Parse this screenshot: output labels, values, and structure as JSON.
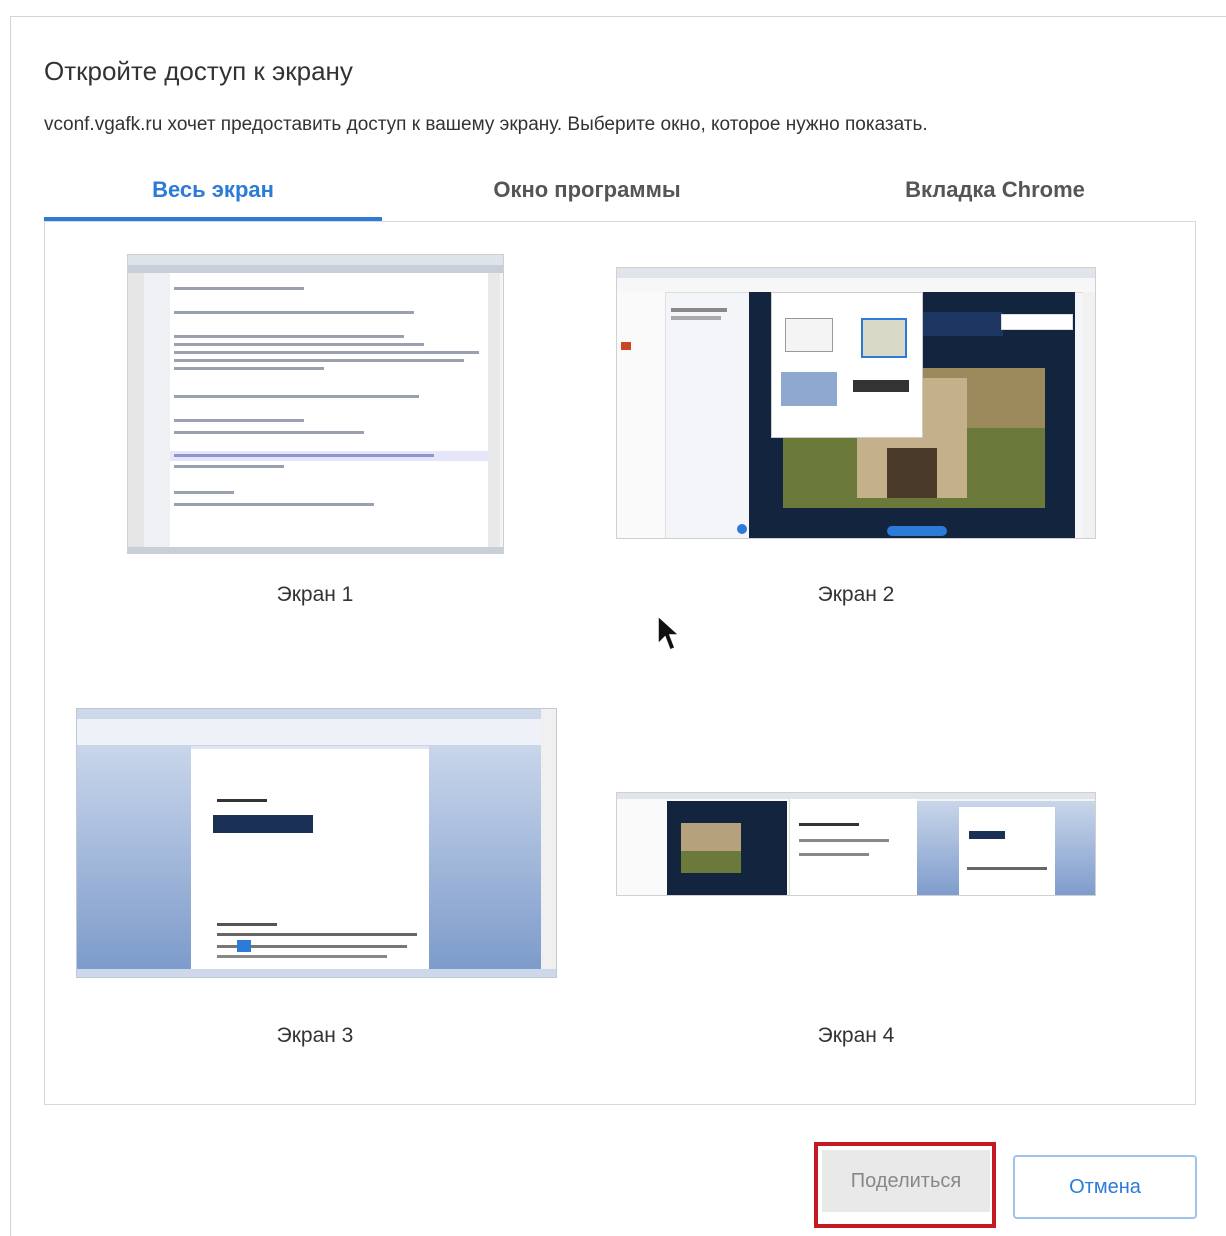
{
  "dialog": {
    "title": "Откройте доступ к экрану",
    "subtitle": "vconf.vgafk.ru хочет предоставить доступ к вашему экрану. Выберите окно, которое нужно показать."
  },
  "tabs": [
    {
      "label": "Весь экран",
      "active": true
    },
    {
      "label": "Окно программы",
      "active": false
    },
    {
      "label": "Вкладка Chrome",
      "active": false
    }
  ],
  "screens": [
    {
      "label": "Экран 1",
      "preview": "code-editor"
    },
    {
      "label": "Экран 2",
      "preview": "browser-video-conference"
    },
    {
      "label": "Экран 3",
      "preview": "word-document"
    },
    {
      "label": "Экран 4",
      "preview": "multi-window"
    }
  ],
  "buttons": {
    "share": "Поделиться",
    "cancel": "Отмена"
  },
  "colors": {
    "accent": "#2c7bd6",
    "highlight": "#c41a22",
    "disabled_bg": "#e9e9e9"
  }
}
